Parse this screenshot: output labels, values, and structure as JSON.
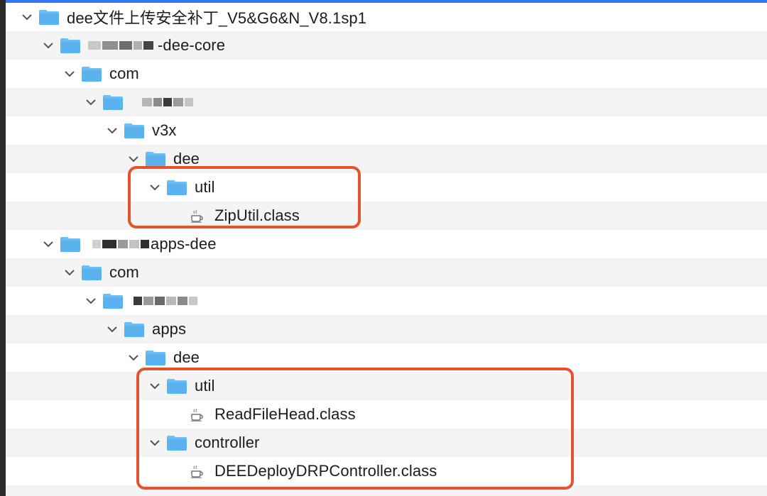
{
  "colors": {
    "accent": "#3478f6",
    "folder": "#5ab2ee",
    "highlight": "#e5532e"
  },
  "tree": {
    "root": "dee文件上传安全补丁_V5&G6&N_V8.1sp1",
    "core_module": "-dee-core",
    "core_com": "com",
    "core_v3x": "v3x",
    "core_dee": "dee",
    "core_util": "util",
    "core_zip": "ZipUtil.class",
    "apps_module": "apps-dee",
    "apps_com": "com",
    "apps_apps": "apps",
    "apps_dee": "dee",
    "apps_util": "util",
    "apps_readfile": "ReadFileHead.class",
    "apps_controller": "controller",
    "apps_deploy": "DEEDeployDRPController.class"
  },
  "icons": {
    "folder": "folder-icon",
    "java": "java-class-icon",
    "chevron": "chevron-down-icon"
  }
}
